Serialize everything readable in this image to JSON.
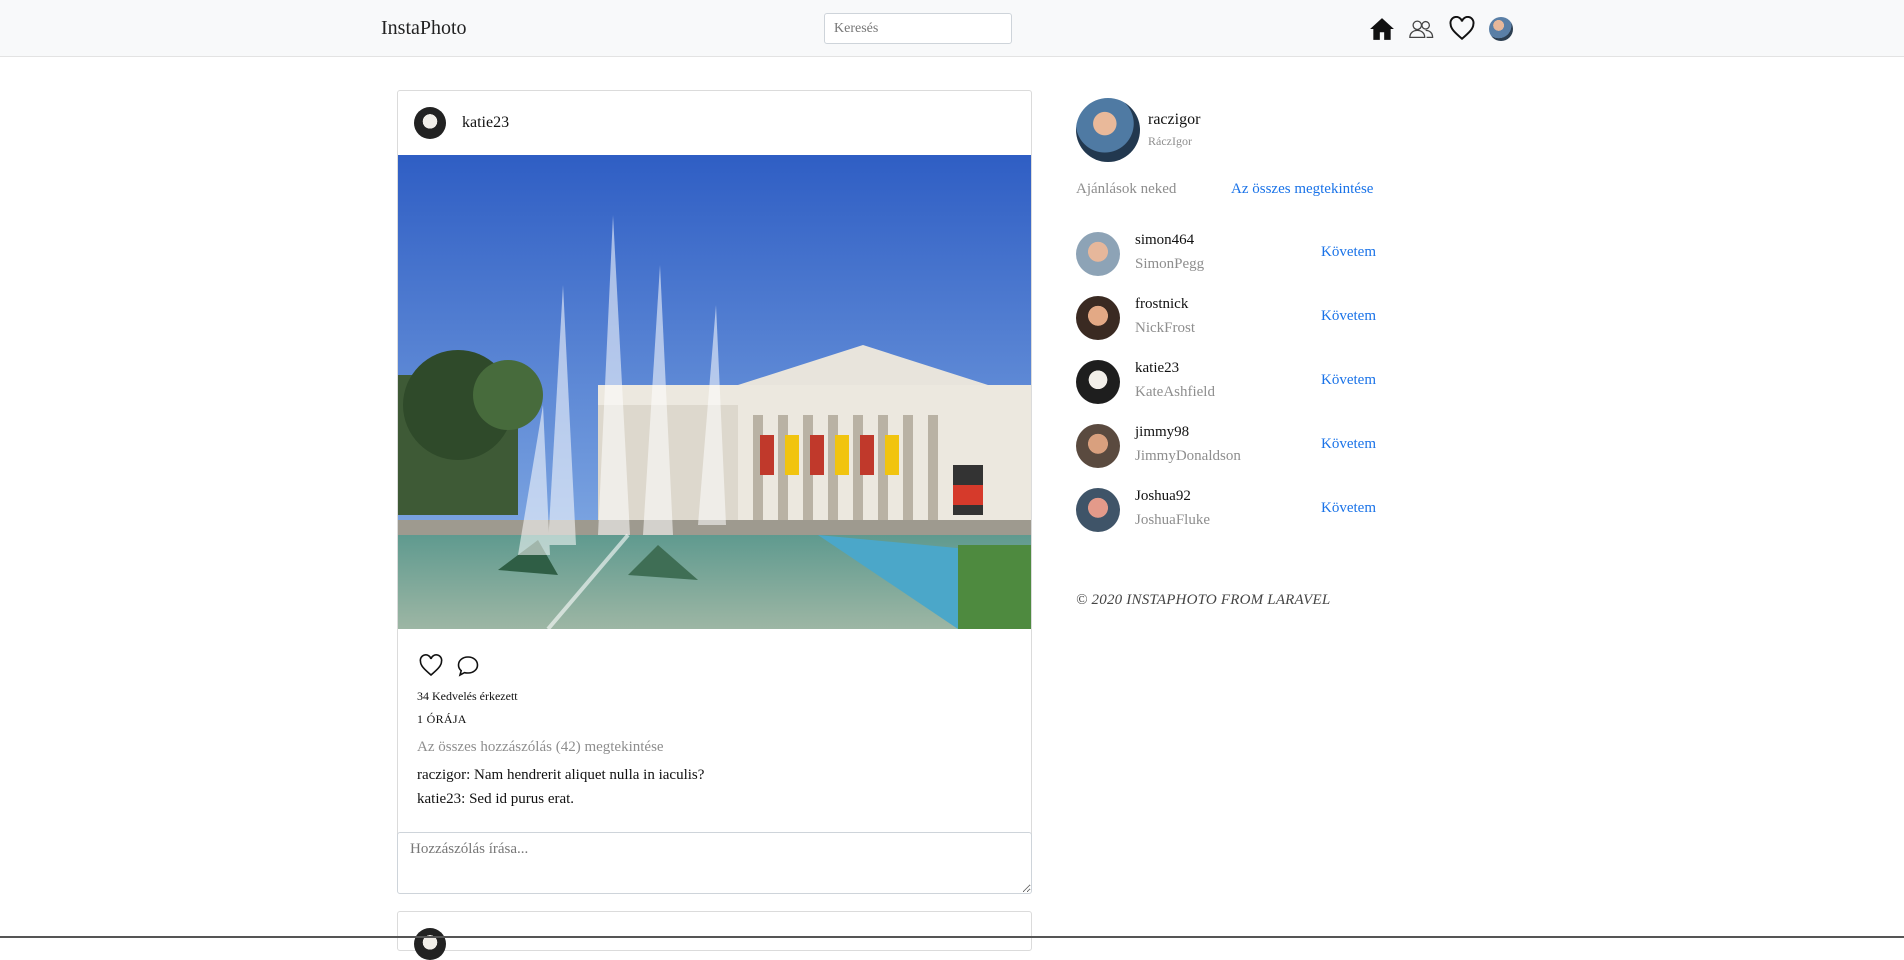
{
  "navbar": {
    "brand": "InstaPhoto",
    "search_placeholder": "Keresés",
    "icons": [
      "home-icon",
      "users-icon",
      "heart-icon",
      "avatar"
    ]
  },
  "post": {
    "username": "katie23",
    "likes_text": "34 Kedvelés érkezett",
    "time_text": "1 ÓRÁJA",
    "view_all_comments": "Az összes hozzászólás (42) megtekintése",
    "comments": [
      {
        "user": "raczigor",
        "text": ": Nam hendrerit aliquet nulla in iaculis?"
      },
      {
        "user": "katie23",
        "text": ": Sed id purus erat."
      }
    ],
    "comment_placeholder": "Hozzászólás írása..."
  },
  "sidebar": {
    "username": "raczigor",
    "fullname": "RáczIgor",
    "suggestions_title": "Ajánlások neked",
    "see_all": "Az összes megtekintése",
    "follow_label": "Követem",
    "suggestions": [
      {
        "username": "simon464",
        "name": "SimonPegg"
      },
      {
        "username": "frostnick",
        "name": "NickFrost"
      },
      {
        "username": "katie23",
        "name": "KateAshfield"
      },
      {
        "username": "jimmy98",
        "name": "JimmyDonaldson"
      },
      {
        "username": "Joshua92",
        "name": "JoshuaFluke"
      }
    ],
    "footer": "© 2020 INSTAPHOTO FROM LARAVEL"
  },
  "colors": {
    "link": "#1a73e8",
    "muted": "#8e8e8e",
    "navbar_bg": "#f8f9fa"
  }
}
